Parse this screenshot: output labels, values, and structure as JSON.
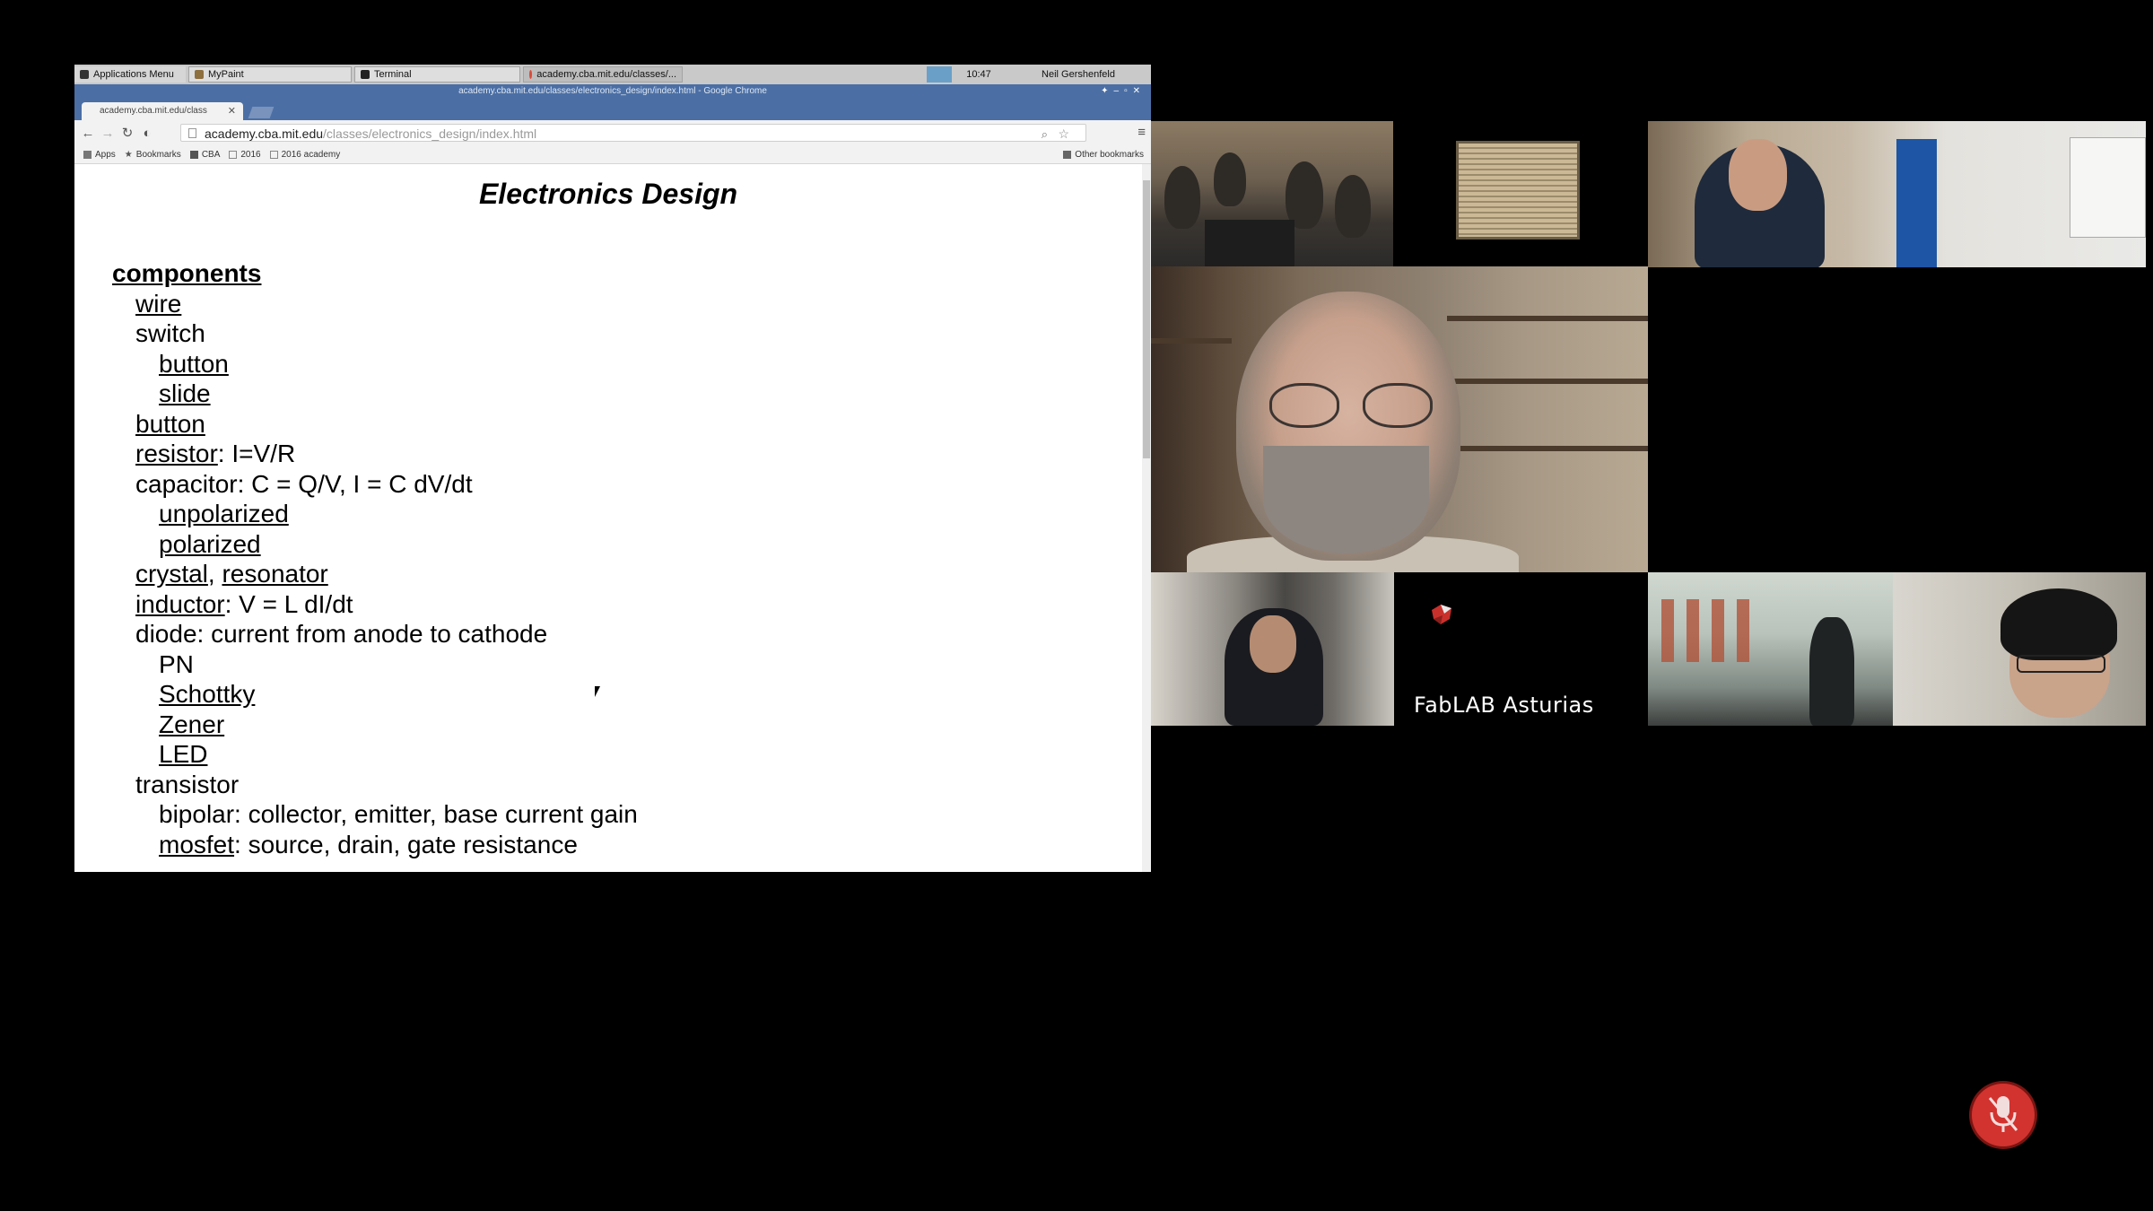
{
  "taskbar": {
    "items": [
      {
        "label": "Applications Menu"
      },
      {
        "label": "MyPaint"
      },
      {
        "label": "Terminal"
      },
      {
        "label": "academy.cba.mit.edu/classes/..."
      }
    ],
    "clock": "10:47",
    "user": "Neil Gershenfeld"
  },
  "browser": {
    "window_title": "academy.cba.mit.edu/classes/electronics_design/index.html - Google Chrome",
    "tab_title": "academy.cba.mit.edu/class",
    "url_host": "academy.cba.mit.edu",
    "url_path": "/classes/electronics_design/index.html",
    "bookmarks": [
      "Apps",
      "Bookmarks",
      "CBA",
      "2016",
      "2016 academy"
    ],
    "other_bookmarks": "Other bookmarks"
  },
  "page": {
    "title": "Electronics Design",
    "outline": [
      {
        "level": 0,
        "link": "components",
        "text": "",
        "heading": true
      },
      {
        "level": 1,
        "link": "wire",
        "text": ""
      },
      {
        "level": 1,
        "link": "",
        "text": "switch"
      },
      {
        "level": 2,
        "link": "button",
        "text": ""
      },
      {
        "level": 2,
        "link": "slide",
        "text": ""
      },
      {
        "level": 1,
        "link": "button",
        "text": ""
      },
      {
        "level": 1,
        "link": "resistor",
        "text": ": I=V/R"
      },
      {
        "level": 1,
        "link": "",
        "text": "capacitor: C = Q/V, I = C dV/dt"
      },
      {
        "level": 2,
        "link": "unpolarized",
        "text": ""
      },
      {
        "level": 2,
        "link": "polarized",
        "text": ""
      },
      {
        "level": 1,
        "link": "crystal",
        "link2": "resonator",
        "text": ", "
      },
      {
        "level": 1,
        "link": "inductor",
        "text": ": V = L dI/dt"
      },
      {
        "level": 1,
        "link": "",
        "text": "diode: current from anode to cathode"
      },
      {
        "level": 2,
        "link": "",
        "text": "PN"
      },
      {
        "level": 2,
        "link": "Schottky",
        "text": ""
      },
      {
        "level": 2,
        "link": "Zener",
        "text": ""
      },
      {
        "level": 2,
        "link": "LED",
        "text": ""
      },
      {
        "level": 1,
        "link": "",
        "text": "transistor"
      },
      {
        "level": 2,
        "link": "",
        "text": "bipolar: collector, emitter, base current gain"
      },
      {
        "level": 2,
        "link": "mosfet",
        "text": ": source, drain, gate resistance"
      }
    ]
  },
  "video": {
    "fablab_label": "FabLAB Asturias"
  },
  "colors": {
    "chrome_frame": "#4b6fa5",
    "mute_button": "#d2332f",
    "background": "#000000"
  },
  "icons": {
    "mute": "microphone-muted-icon"
  }
}
